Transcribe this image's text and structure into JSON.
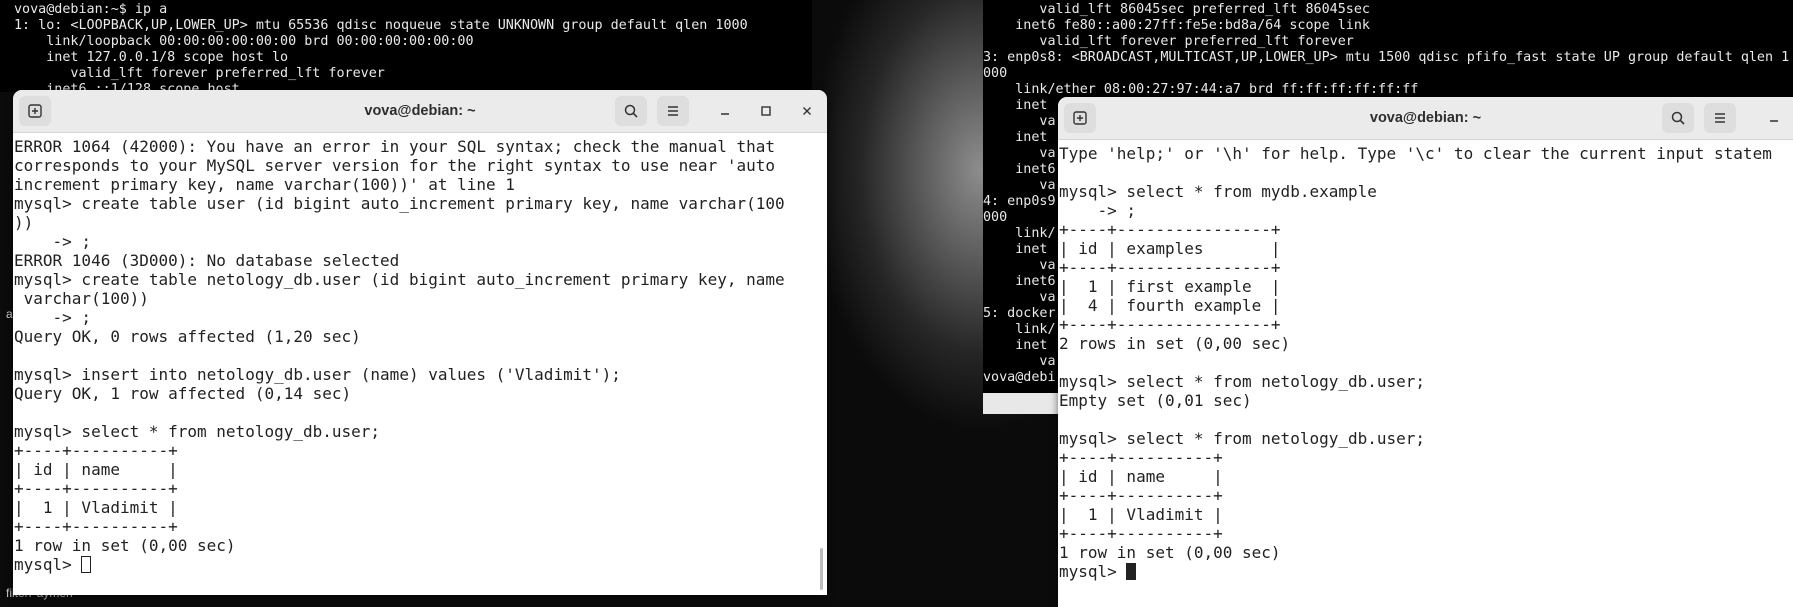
{
  "desktop": {
    "label_a": "a",
    "bottom_label": "filterPaymen-"
  },
  "bg_terminal_left": {
    "lines": [
      "vova@debian:~$ ip a",
      "1: lo: <LOOPBACK,UP,LOWER_UP> mtu 65536 qdisc noqueue state UNKNOWN group default qlen 1000",
      "    link/loopback 00:00:00:00:00:00 brd 00:00:00:00:00:00",
      "    inet 127.0.0.1/8 scope host lo",
      "       valid_lft forever preferred_lft forever",
      "    inet6 ::1/128 scope host"
    ]
  },
  "bg_terminal_right": {
    "lines": [
      "       valid_lft 86045sec preferred_lft 86045sec",
      "    inet6 fe80::a00:27ff:fe5e:bd8a/64 scope link",
      "       valid_lft forever preferred_lft forever",
      "3: enp0s8: <BROADCAST,MULTICAST,UP,LOWER_UP> mtu 1500 qdisc pfifo_fast state UP group default qlen 1",
      "000",
      "    link/ether 08:00:27:97:44:a7 brd ff:ff:ff:ff:ff:ff",
      "    inet",
      "       va",
      "    inet",
      "       va",
      "    inet6",
      "       va",
      "4: enp0s9",
      "000",
      "    link/",
      "    inet",
      "       va",
      "    inet6",
      "       va",
      "5: docker",
      "    link/",
      "    inet",
      "       va",
      "vova@debi"
    ]
  },
  "terminal_left": {
    "title": "vova@debian: ~",
    "icons": {
      "new_tab": "new-tab-icon",
      "search": "search-icon",
      "menu": "hamburger-menu-icon",
      "minimize": "minimize-icon",
      "maximize": "maximize-icon",
      "close": "close-icon"
    },
    "lines": [
      "ERROR 1064 (42000): You have an error in your SQL syntax; check the manual that",
      "corresponds to your MySQL server version for the right syntax to use near 'auto",
      "increment primary key, name varchar(100))' at line 1",
      "mysql> create table user (id bigint auto_increment primary key, name varchar(100",
      "))",
      "    -> ;",
      "ERROR 1046 (3D000): No database selected",
      "mysql> create table netology_db.user (id bigint auto_increment primary key, name",
      " varchar(100))",
      "    -> ;",
      "Query OK, 0 rows affected (1,20 sec)",
      "",
      "mysql> insert into netology_db.user (name) values ('Vladimit');",
      "Query OK, 1 row affected (0,14 sec)",
      "",
      "mysql> select * from netology_db.user;",
      "+----+----------+",
      "| id | name     |",
      "+----+----------+",
      "|  1 | Vladimit |",
      "+----+----------+",
      "1 row in set (0,00 sec)",
      ""
    ],
    "prompt": "mysql> "
  },
  "terminal_right": {
    "title": "vova@debian: ~",
    "icons": {
      "new_tab": "new-tab-icon",
      "search": "search-icon",
      "menu": "hamburger-menu-icon",
      "minimize": "minimize-icon"
    },
    "lines": [
      "Type 'help;' or '\\h' for help. Type '\\c' to clear the current input statem",
      "",
      "mysql> select * from mydb.example",
      "    -> ;",
      "+----+----------------+",
      "| id | examples       |",
      "+----+----------------+",
      "|  1 | first example  |",
      "|  4 | fourth example |",
      "+----+----------------+",
      "2 rows in set (0,00 sec)",
      "",
      "mysql> select * from netology_db.user;",
      "Empty set (0,01 sec)",
      "",
      "mysql> select * from netology_db.user;",
      "+----+----------+",
      "| id | name     |",
      "+----+----------+",
      "|  1 | Vladimit |",
      "+----+----------+",
      "1 row in set (0,00 sec)",
      ""
    ],
    "prompt": "mysql> "
  }
}
